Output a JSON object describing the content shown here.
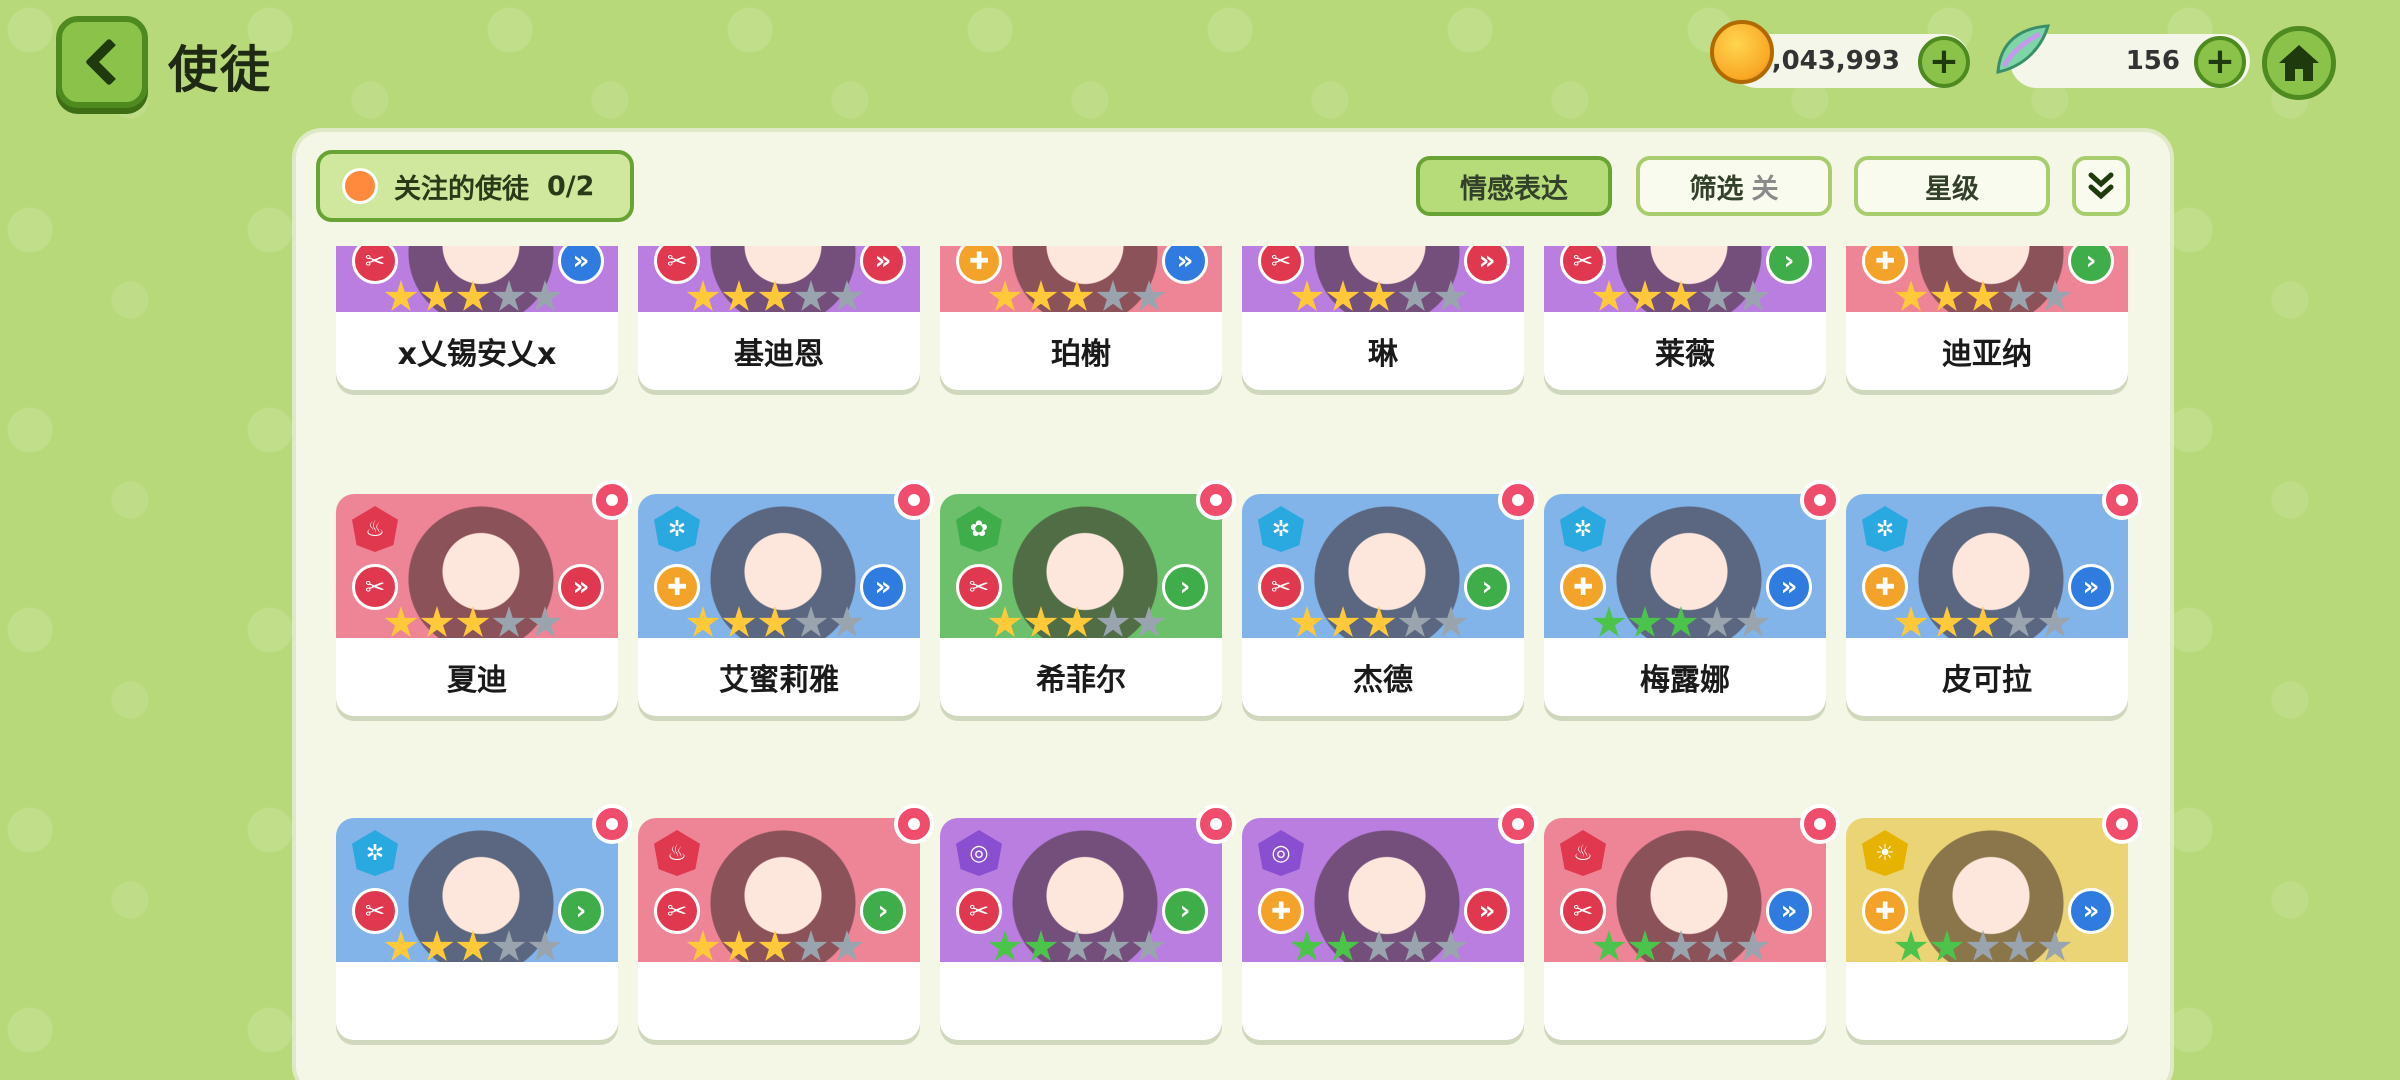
{
  "header": {
    "title": "使徒",
    "coins": "2,043,993",
    "gems": "156"
  },
  "toolbar": {
    "favorite_label": "关注的使徒",
    "favorite_count": "0/2",
    "emotion_label": "情感表达",
    "filter_label": "筛选",
    "filter_state": "关",
    "star_label": "星级"
  },
  "colors": {
    "purple": "#b97ee0",
    "blue": "#82b4ea",
    "pink": "#ee8596",
    "green": "#6cc06c",
    "yellow": "#ebd475",
    "star_gold": "#ffc93a",
    "star_green": "#4cc44c",
    "star_empty": "#9aa4ae"
  },
  "apostles": [
    {
      "name": "x乂锡安乂x",
      "bg": "purple",
      "element": "void",
      "role": "attacker",
      "class": "ranged",
      "stars": 3,
      "star_color": "gold",
      "favorite": false
    },
    {
      "name": "基迪恩",
      "bg": "purple",
      "element": "void",
      "role": "attacker",
      "class": "melee",
      "stars": 3,
      "star_color": "gold",
      "favorite": false
    },
    {
      "name": "珀榭",
      "bg": "pink",
      "element": "void",
      "role": "supporter",
      "class": "ranged",
      "stars": 3,
      "star_color": "gold",
      "favorite": false
    },
    {
      "name": "琳",
      "bg": "purple",
      "element": "void",
      "role": "attacker",
      "class": "melee",
      "stars": 3,
      "star_color": "gold",
      "favorite": false
    },
    {
      "name": "莱薇",
      "bg": "purple",
      "element": "void",
      "role": "attacker",
      "class": "mid",
      "stars": 3,
      "star_color": "gold",
      "favorite": false
    },
    {
      "name": "迪亚纳",
      "bg": "pink",
      "element": "fire",
      "role": "supporter",
      "class": "mid",
      "stars": 3,
      "star_color": "gold",
      "favorite": false
    },
    {
      "name": "夏迪",
      "bg": "pink",
      "element": "fire",
      "role": "attacker",
      "class": "melee",
      "stars": 3,
      "star_color": "gold",
      "favorite": true
    },
    {
      "name": "艾蜜莉雅",
      "bg": "blue",
      "element": "ice",
      "role": "supporter",
      "class": "ranged",
      "stars": 3,
      "star_color": "gold",
      "favorite": true
    },
    {
      "name": "希菲尔",
      "bg": "green",
      "element": "nature",
      "role": "attacker",
      "class": "mid",
      "stars": 3,
      "star_color": "gold",
      "favorite": true
    },
    {
      "name": "杰德",
      "bg": "blue",
      "element": "ice",
      "role": "attacker",
      "class": "mid",
      "stars": 3,
      "star_color": "gold",
      "favorite": true
    },
    {
      "name": "梅露娜",
      "bg": "blue",
      "element": "ice",
      "role": "supporter",
      "class": "ranged",
      "stars": 3,
      "star_color": "green",
      "favorite": true
    },
    {
      "name": "皮可拉",
      "bg": "blue",
      "element": "ice",
      "role": "supporter",
      "class": "ranged",
      "stars": 3,
      "star_color": "gold",
      "favorite": true
    },
    {
      "name": "",
      "bg": "blue",
      "element": "ice",
      "role": "attacker",
      "class": "mid",
      "stars": 3,
      "star_color": "gold",
      "favorite": true
    },
    {
      "name": "",
      "bg": "pink",
      "element": "fire",
      "role": "attacker",
      "class": "mid",
      "stars": 3,
      "star_color": "gold",
      "favorite": true
    },
    {
      "name": "",
      "bg": "purple",
      "element": "void",
      "role": "attacker",
      "class": "mid",
      "stars": 2,
      "star_color": "green",
      "favorite": true
    },
    {
      "name": "",
      "bg": "purple",
      "element": "void",
      "role": "supporter",
      "class": "melee",
      "stars": 2,
      "star_color": "green",
      "favorite": true
    },
    {
      "name": "",
      "bg": "pink",
      "element": "fire",
      "role": "attacker",
      "class": "ranged",
      "stars": 2,
      "star_color": "green",
      "favorite": true
    },
    {
      "name": "",
      "bg": "yellow",
      "element": "light",
      "role": "supporter",
      "class": "ranged",
      "stars": 2,
      "star_color": "green",
      "favorite": true
    }
  ]
}
